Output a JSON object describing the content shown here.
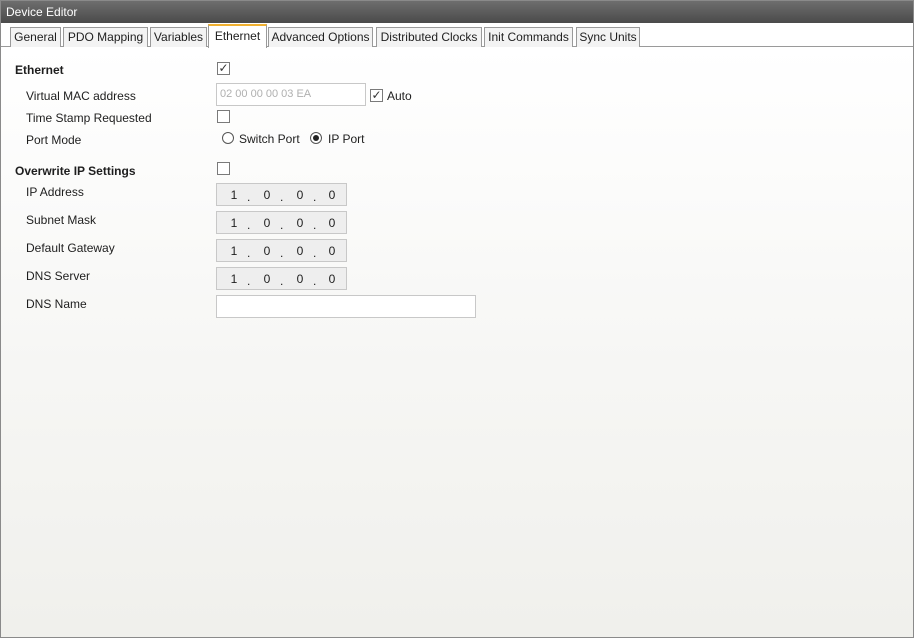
{
  "window": {
    "title": "Device Editor"
  },
  "tabs": [
    {
      "label": "General"
    },
    {
      "label": "PDO Mapping"
    },
    {
      "label": "Variables"
    },
    {
      "label": "Ethernet"
    },
    {
      "label": "Advanced Options"
    },
    {
      "label": "Distributed Clocks"
    },
    {
      "label": "Init Commands"
    },
    {
      "label": "Sync Units"
    }
  ],
  "active_tab": "Ethernet",
  "ethernet": {
    "label": "Ethernet",
    "checked": true,
    "mac": {
      "label": "Virtual MAC address",
      "value": "02 00 00 00 03 EA",
      "auto_label": "Auto",
      "auto_checked": true
    },
    "timestamp": {
      "label": "Time Stamp Requested",
      "checked": false
    },
    "port_mode": {
      "label": "Port Mode",
      "options": [
        "Switch Port",
        "IP Port"
      ],
      "selected": "IP Port"
    }
  },
  "overwrite_ip": {
    "label": "Overwrite IP Settings",
    "checked": false,
    "ip_address": {
      "label": "IP Address",
      "octets": [
        "1",
        "0",
        "0",
        "0"
      ]
    },
    "subnet_mask": {
      "label": "Subnet Mask",
      "octets": [
        "1",
        "0",
        "0",
        "0"
      ]
    },
    "default_gateway": {
      "label": "Default Gateway",
      "octets": [
        "1",
        "0",
        "0",
        "0"
      ]
    },
    "dns_server": {
      "label": "DNS Server",
      "octets": [
        "1",
        "0",
        "0",
        "0"
      ]
    },
    "dns_name": {
      "label": "DNS Name",
      "value": ""
    }
  },
  "glyphs": {
    "check": "✓",
    "dot": "."
  }
}
